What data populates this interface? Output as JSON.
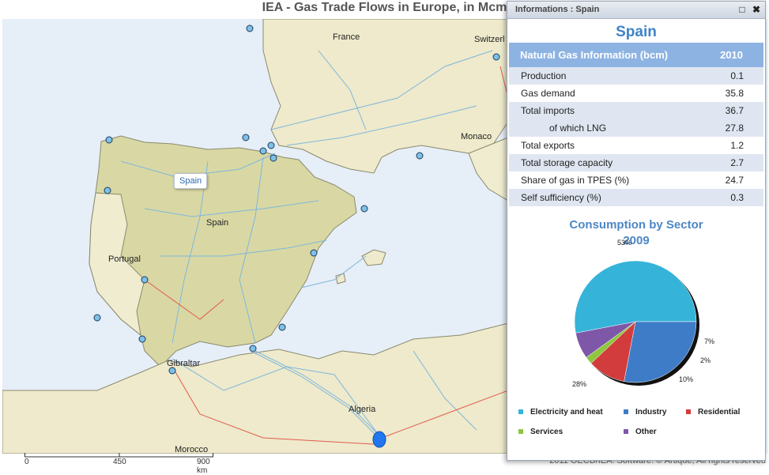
{
  "page": {
    "title": "IEA - Gas Trade Flows in Europe, in Mcm"
  },
  "map": {
    "labels": {
      "france": "France",
      "switzerland": "Switzerl",
      "monaco": "Monaco",
      "spain": "Spain",
      "portugal": "Portugal",
      "gibraltar": "Gibraltar",
      "algeria": "Algeria",
      "morocco": "Morocco"
    },
    "tooltip": "Spain",
    "scale": {
      "t0": "0",
      "t1": "450",
      "t2": "900 km"
    },
    "copyright": "2011 OECD/IEA. Software: © Artique, All rights reserved"
  },
  "panel": {
    "header": "Informations : Spain",
    "maximize_icon": "maximize-icon",
    "close_icon": "close-icon",
    "title": "Spain",
    "table": {
      "header_label": "Natural Gas Information (bcm)",
      "header_year": "2010",
      "rows": [
        {
          "label": "Production",
          "value": "0.1"
        },
        {
          "label": "Gas demand",
          "value": "35.8"
        },
        {
          "label": "Total imports",
          "value": "36.7"
        },
        {
          "label": "of which LNG",
          "value": "27.8"
        },
        {
          "label": "Total exports",
          "value": "1.2"
        },
        {
          "label": "Total storage capacity",
          "value": "2.7"
        },
        {
          "label": "Share of gas in TPES (%)",
          "value": "24.7"
        },
        {
          "label": "Self sufficiency (%)",
          "value": "0.3"
        }
      ]
    },
    "chart_title_line1": "Consumption by Sector",
    "chart_title_line2": "2009"
  },
  "chart_data": {
    "type": "pie",
    "title": "Consumption by Sector 2009",
    "legend_position": "bottom",
    "slices": [
      {
        "name": "Electricity and heat",
        "value": 53,
        "label": "53%",
        "color": "#36b3d9"
      },
      {
        "name": "Industry",
        "value": 28,
        "label": "28%",
        "color": "#3f7cc7"
      },
      {
        "name": "Residential",
        "value": 10,
        "label": "10%",
        "color": "#d23c3c"
      },
      {
        "name": "Services",
        "value": 2,
        "label": "2%",
        "color": "#8dc63f"
      },
      {
        "name": "Other",
        "value": 7,
        "label": "7%",
        "color": "#7e57a8"
      }
    ]
  }
}
